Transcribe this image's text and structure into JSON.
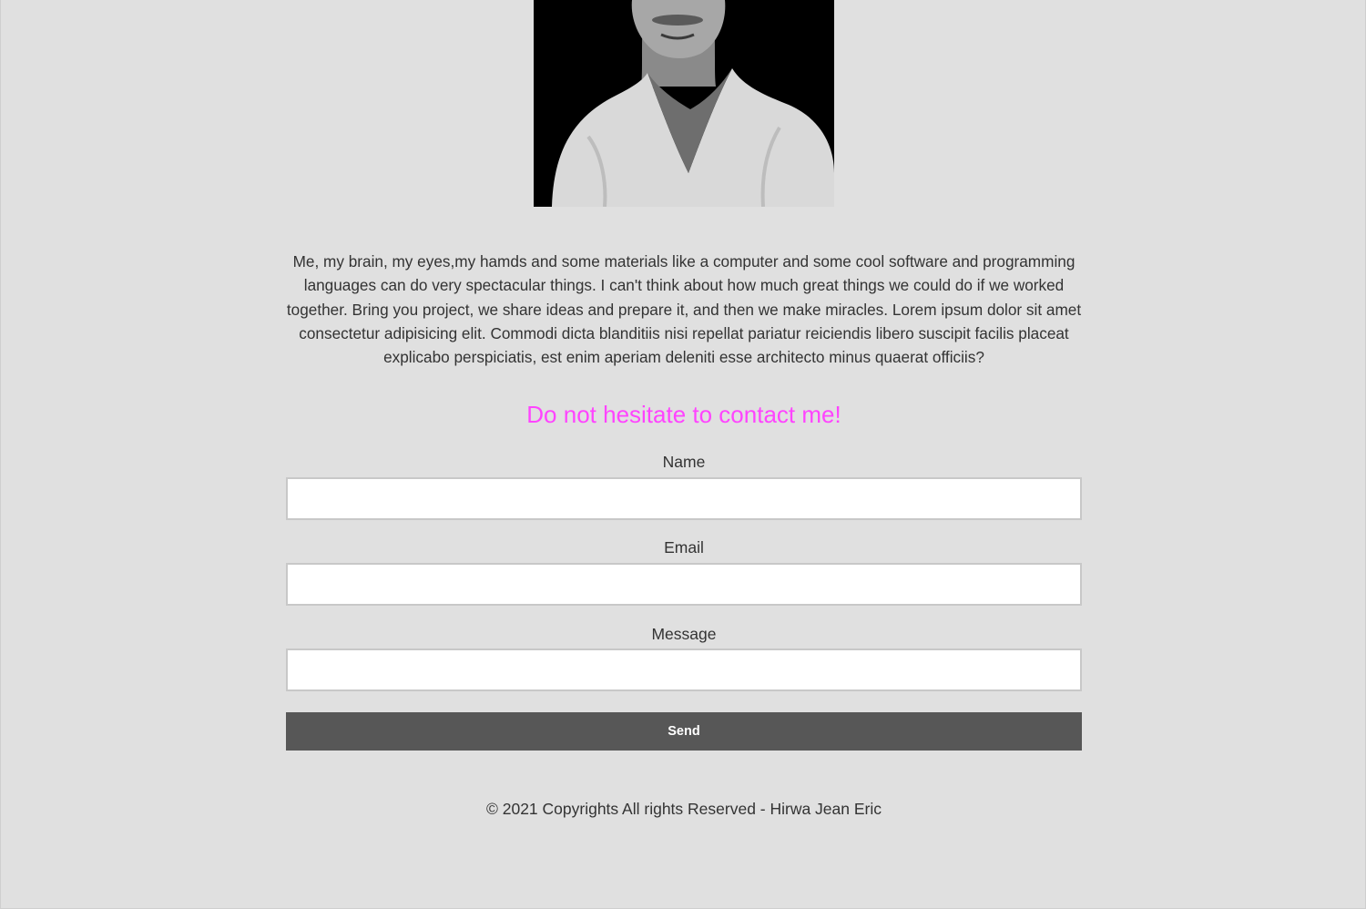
{
  "about": {
    "text": "Me, my brain, my eyes,my hamds and some materials like a computer and some cool software and programming languages can do very spectacular things. I can't think about how much great things we could do if we worked together. Bring you project, we share ideas and prepare it, and then we make miracles. Lorem ipsum dolor sit amet consectetur adipisicing elit. Commodi dicta blanditiis nisi repellat pariatur reiciendis libero suscipit facilis placeat explicabo perspiciatis, est enim aperiam deleniti esse architecto minus quaerat officiis?"
  },
  "contact": {
    "heading": "Do not hesitate to contact me!",
    "heading_color": "#ff44ff",
    "fields": [
      {
        "label": "Name",
        "value": "",
        "placeholder": ""
      },
      {
        "label": "Email",
        "value": "",
        "placeholder": ""
      },
      {
        "label": "Message",
        "value": "",
        "placeholder": ""
      }
    ],
    "send_label": "Send",
    "send_color": "#575757"
  },
  "footer": {
    "text": "© 2021 Copyrights All rights Reserved - Hirwa Jean Eric"
  },
  "colors": {
    "background": "#e0e0e0",
    "text": "#333333"
  }
}
